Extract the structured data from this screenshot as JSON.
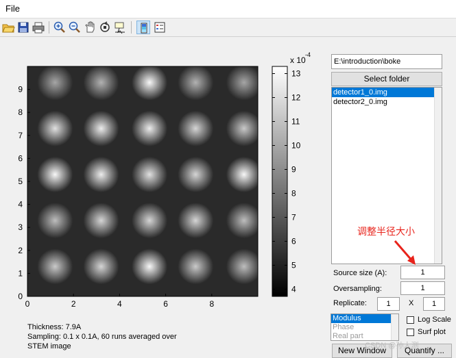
{
  "menu": {
    "file": "File"
  },
  "toolbar": {
    "open": "folder-open-icon",
    "save": "save-icon",
    "print": "print-icon",
    "zoom_in": "zoom-in-icon",
    "zoom_out": "zoom-out-icon",
    "pan": "pan-hand-icon",
    "rotate": "rotate-3d-icon",
    "data_cursor": "data-cursor-icon",
    "colorbar": "colorbar-icon",
    "legend": "legend-icon"
  },
  "plot": {
    "x_ticks": [
      "0",
      "2",
      "4",
      "6",
      "8"
    ],
    "y_ticks": [
      "0",
      "1",
      "2",
      "3",
      "4",
      "5",
      "6",
      "7",
      "8",
      "9"
    ],
    "colorbar_exponent": "x 10",
    "colorbar_exponent_power": "-4",
    "colorbar_ticks": [
      "4",
      "5",
      "6",
      "7",
      "8",
      "9",
      "10",
      "11",
      "12",
      "13"
    ],
    "colormap": "gray"
  },
  "chart_data": {
    "type": "heatmap",
    "xlim": [
      0,
      10
    ],
    "ylim": [
      0,
      10
    ],
    "clim": [
      3.7,
      13.3
    ],
    "colorbar_scale": "x 10^-4",
    "peaks": [
      {
        "x": 1.2,
        "y": 9.3,
        "v": 9.5
      },
      {
        "x": 3.2,
        "y": 9.3,
        "v": 10.0
      },
      {
        "x": 5.3,
        "y": 9.3,
        "v": 13.0
      },
      {
        "x": 7.3,
        "y": 9.3,
        "v": 10.0
      },
      {
        "x": 9.4,
        "y": 9.3,
        "v": 9.5
      },
      {
        "x": 1.2,
        "y": 7.3,
        "v": 12.0
      },
      {
        "x": 3.2,
        "y": 7.3,
        "v": 12.5
      },
      {
        "x": 5.3,
        "y": 7.3,
        "v": 12.5
      },
      {
        "x": 7.3,
        "y": 7.3,
        "v": 11.5
      },
      {
        "x": 9.4,
        "y": 7.3,
        "v": 11.0
      },
      {
        "x": 1.2,
        "y": 5.3,
        "v": 13.0
      },
      {
        "x": 3.2,
        "y": 5.3,
        "v": 12.5
      },
      {
        "x": 5.3,
        "y": 5.3,
        "v": 12.0
      },
      {
        "x": 7.3,
        "y": 5.3,
        "v": 11.5
      },
      {
        "x": 9.4,
        "y": 5.3,
        "v": 13.0
      },
      {
        "x": 1.2,
        "y": 3.3,
        "v": 10.5
      },
      {
        "x": 3.2,
        "y": 3.3,
        "v": 11.5
      },
      {
        "x": 5.3,
        "y": 3.3,
        "v": 11.5
      },
      {
        "x": 7.3,
        "y": 3.3,
        "v": 11.5
      },
      {
        "x": 9.4,
        "y": 3.3,
        "v": 10.5
      },
      {
        "x": 1.2,
        "y": 1.3,
        "v": 11.0
      },
      {
        "x": 3.2,
        "y": 1.3,
        "v": 11.5
      },
      {
        "x": 5.3,
        "y": 1.3,
        "v": 13.0
      },
      {
        "x": 7.3,
        "y": 1.3,
        "v": 11.0
      },
      {
        "x": 9.4,
        "y": 1.3,
        "v": 10.5
      }
    ],
    "background_level": 4.2
  },
  "captions": {
    "thickness": "Thickness: 7.9A",
    "sampling": "Sampling: 0.1 x 0.1A, 60 runs averaged over",
    "stem": "STEM image"
  },
  "right_panel": {
    "path_value": "E:\\introduction\\boke",
    "select_folder": "Select folder",
    "files": [
      "detector1_0.img",
      "detector2_0.img"
    ],
    "annotation": "调整半径大小",
    "source_size_label": "Source size (A):",
    "source_size_value": "1",
    "oversampling_label": "Oversampling:",
    "oversampling_value": "1",
    "replicate_label": "Replicate:",
    "replicate_x": "1",
    "replicate_sep": "X",
    "replicate_y": "1",
    "display_modes": [
      "Modulus",
      "Phase",
      "Real part"
    ],
    "log_scale_label": "Log Scale",
    "surf_plot_label": "Surf plot",
    "new_window": "New Window",
    "quantify": "Quantify ...",
    "watermark": "CSDN @孙大测"
  },
  "colors": {
    "selection": "#0078d7",
    "annotation": "#e8231b"
  }
}
